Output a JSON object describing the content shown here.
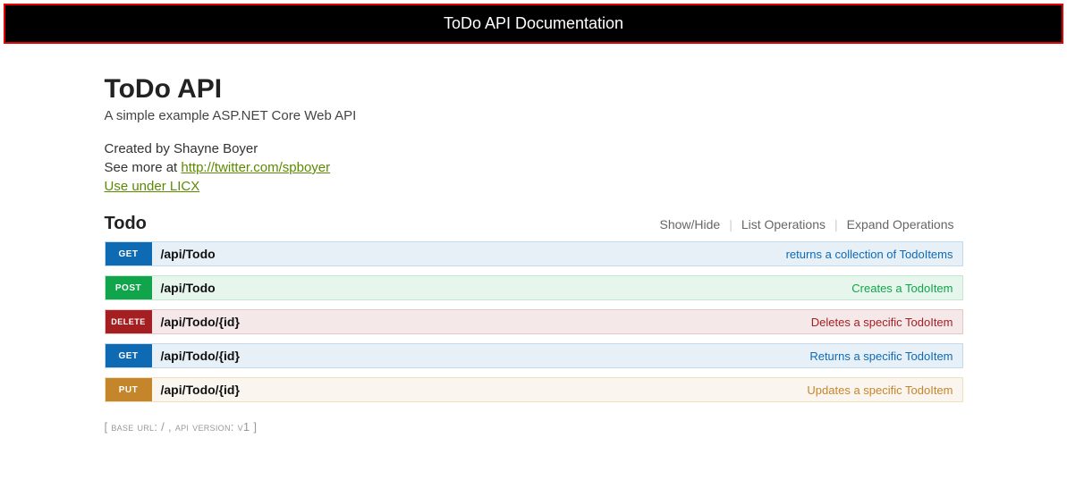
{
  "banner": {
    "title": "ToDo API Documentation"
  },
  "header": {
    "title": "ToDo API",
    "subtitle": "A simple example ASP.NET Core Web API",
    "created_by_prefix": "Created by ",
    "created_by_name": "Shayne Boyer",
    "see_more_prefix": "See more at ",
    "see_more_link_text": "http://twitter.com/spboyer",
    "license_link_text": "Use under LICX"
  },
  "section": {
    "title": "Todo",
    "actions": {
      "show_hide": "Show/Hide",
      "list_ops": "List Operations",
      "expand_ops": "Expand Operations"
    }
  },
  "endpoints": [
    {
      "method": "GET",
      "method_class": "get",
      "path": "/api/Todo",
      "description": "returns a collection of TodoItems"
    },
    {
      "method": "POST",
      "method_class": "post",
      "path": "/api/Todo",
      "description": "Creates a TodoItem"
    },
    {
      "method": "DELETE",
      "method_class": "delete",
      "path": "/api/Todo/{id}",
      "description": "Deletes a specific TodoItem"
    },
    {
      "method": "GET",
      "method_class": "get",
      "path": "/api/Todo/{id}",
      "description": "Returns a specific TodoItem"
    },
    {
      "method": "PUT",
      "method_class": "put",
      "path": "/api/Todo/{id}",
      "description": "Updates a specific TodoItem"
    }
  ],
  "footer": {
    "text": "[ base url: / , api version: v1 ]"
  }
}
